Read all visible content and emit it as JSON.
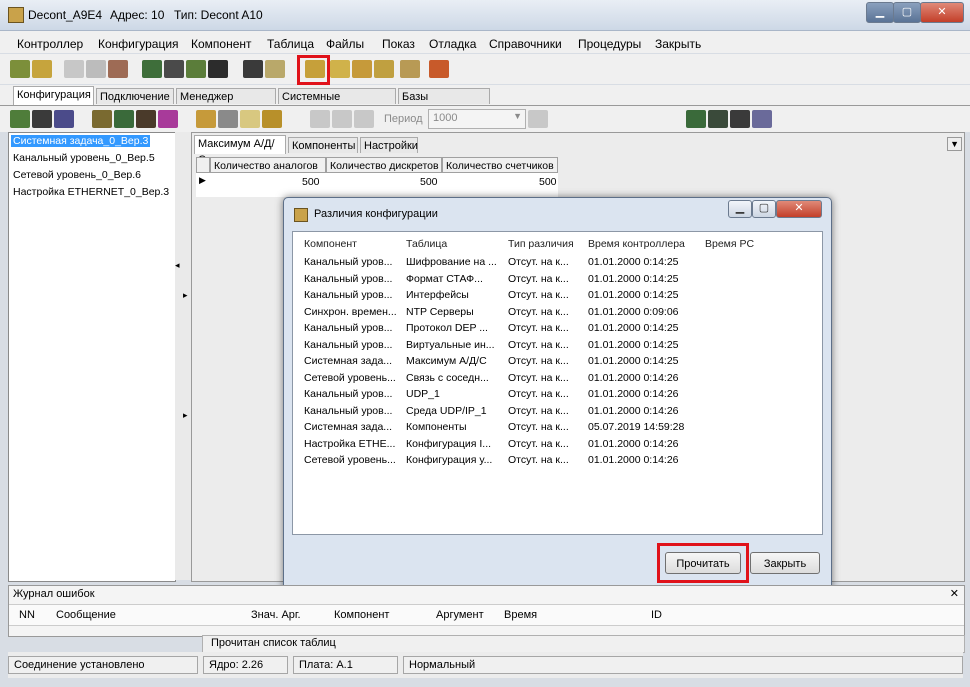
{
  "window": {
    "title": "Decont_A9E4",
    "address": "Адрес: 10",
    "type": "Тип: Decont A10"
  },
  "menu": [
    "Контроллер",
    "Конфигурация",
    "Компонент",
    "Таблица",
    "Файлы",
    "Показ",
    "Отладка",
    "Справочники",
    "Процедуры",
    "Закрыть"
  ],
  "tabs": [
    "Конфигурация",
    "Подключение",
    "Менеджер файлов",
    "Системные параметры",
    "Базы параметров"
  ],
  "toolbar2": {
    "period_label": "Период",
    "period_value": "1000"
  },
  "tree": [
    "Системная задача_0_Вер.3",
    "Канальный уровень_0_Вер.5",
    "Сетевой уровень_0_Вер.6",
    "Настройка ETHERNET_0_Вер.3"
  ],
  "subtabs": [
    "Максимум А/Д/С",
    "Компоненты",
    "Настройки"
  ],
  "grid": {
    "headers": [
      "Количество аналогов",
      "Количество дискретов",
      "Количество счетчиков"
    ],
    "values": [
      "500",
      "500",
      "500"
    ]
  },
  "dialog": {
    "title": "Различия конфигурации",
    "columns": [
      "Компонент",
      "Таблица",
      "Тип различия",
      "Время контроллера",
      "Время PC"
    ],
    "rows": [
      [
        "Канальный уров...",
        "Шифрование на ...",
        "Отсут. на к...",
        "01.01.2000 0:14:25"
      ],
      [
        "Канальный уров...",
        "Формат СТАФ...",
        "Отсут. на к...",
        "01.01.2000 0:14:25"
      ],
      [
        "Канальный уров...",
        "Интерфейсы",
        "Отсут. на к...",
        "01.01.2000 0:14:25"
      ],
      [
        "Синхрон. времен...",
        "NTP Серверы",
        "Отсут. на к...",
        "01.01.2000 0:09:06"
      ],
      [
        "Канальный уров...",
        "Протокол DEP ...",
        "Отсут. на к...",
        "01.01.2000 0:14:25"
      ],
      [
        "Канальный уров...",
        "Виртуальные ин...",
        "Отсут. на к...",
        "01.01.2000 0:14:25"
      ],
      [
        "Системная зада...",
        "Максимум А/Д/С",
        "Отсут. на к...",
        "01.01.2000 0:14:25"
      ],
      [
        "Сетевой уровень...",
        "Связь с соседн...",
        "Отсут. на к...",
        "01.01.2000 0:14:26"
      ],
      [
        "Канальный уров...",
        "UDP_1",
        "Отсут. на к...",
        "01.01.2000 0:14:26"
      ],
      [
        "Канальный уров...",
        "Среда UDP/IP_1",
        "Отсут. на к...",
        "01.01.2000 0:14:26"
      ],
      [
        "Системная зада...",
        "Компоненты",
        "Отсут. на к...",
        "05.07.2019 14:59:28"
      ],
      [
        "Настройка ETHE...",
        "Конфигурация I...",
        "Отсут. на к...",
        "01.01.2000 0:14:26"
      ],
      [
        "Сетевой уровень...",
        "Конфигурация у...",
        "Отсут. на к...",
        "01.01.2000 0:14:26"
      ]
    ],
    "read_button": "Прочитать",
    "close_button": "Закрыть"
  },
  "errlog": {
    "title": "Журнал ошибок",
    "columns": [
      "NN",
      "Сообщение",
      "Знач. Арг.",
      "Компонент",
      "Аргумент",
      "Время",
      "ID"
    ]
  },
  "info_line": "Прочитан список таблиц",
  "status": [
    "Соединение установлено",
    "Ядро: 2.26",
    "Плата: А.1",
    "Нормальный"
  ],
  "colors": {
    "accent": "#e0121a",
    "selection": "#3399ff"
  }
}
